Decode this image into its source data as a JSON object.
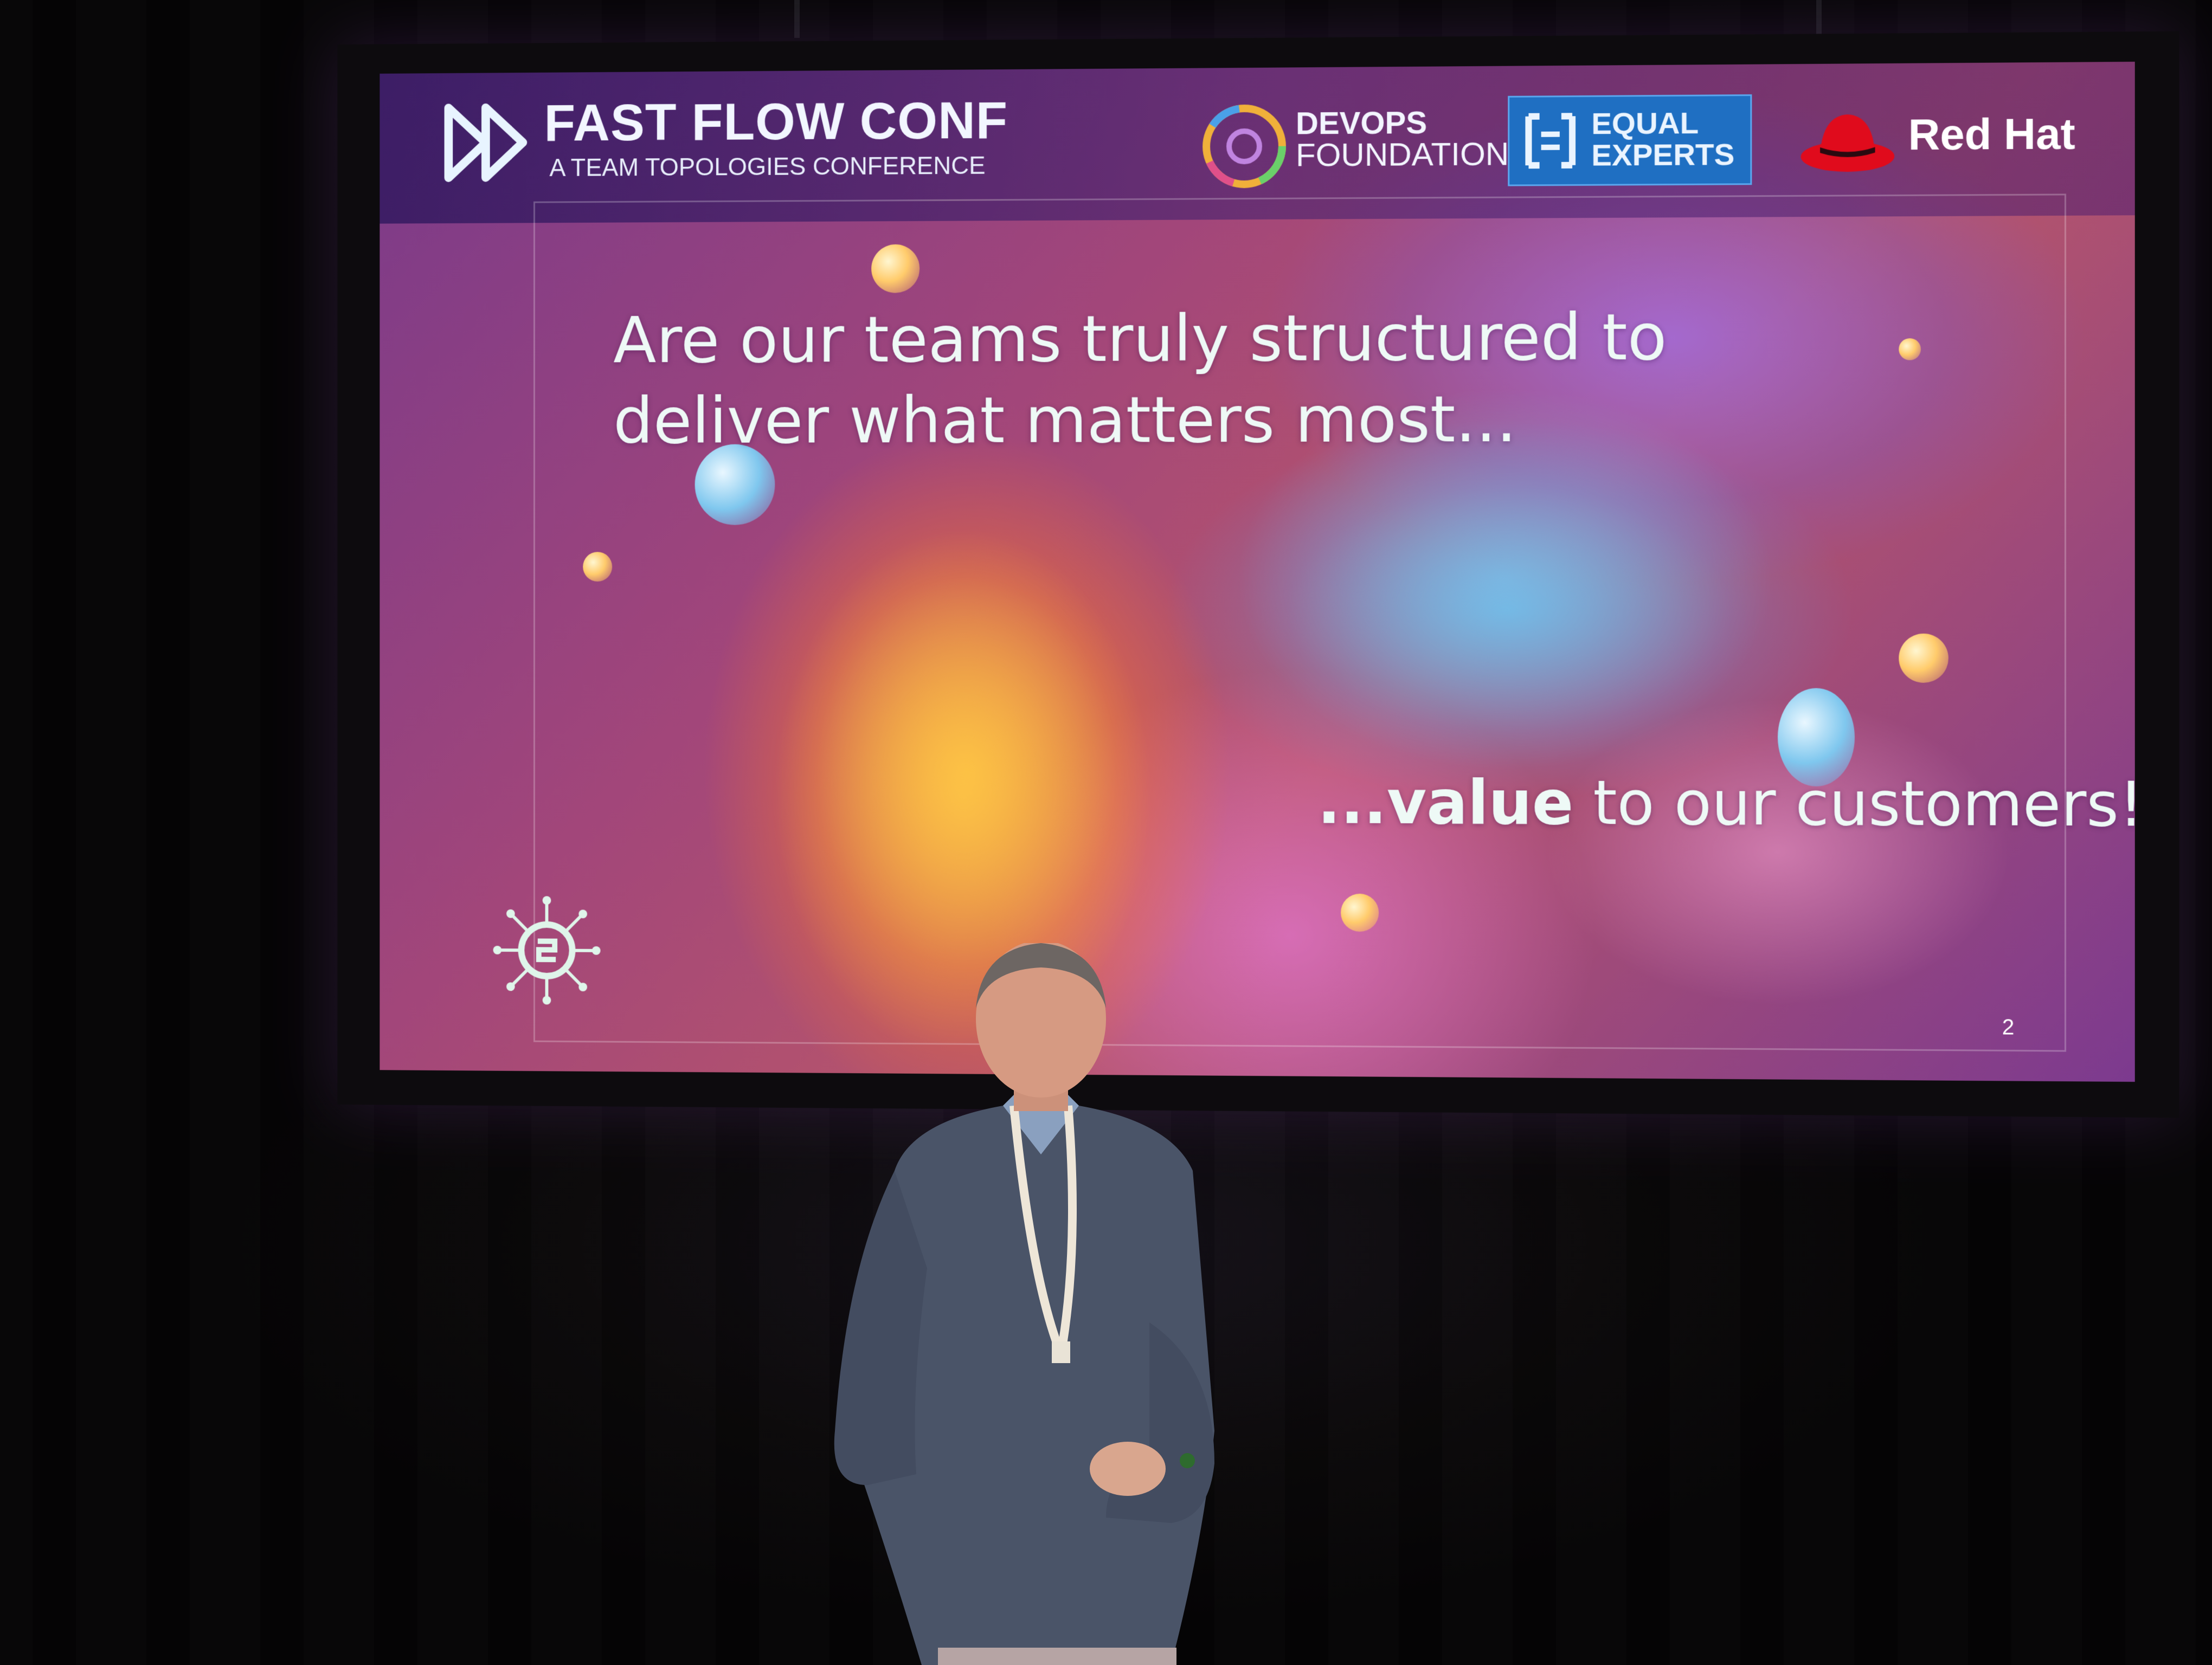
{
  "conference": {
    "name": "FAST FLOW CONF",
    "tagline": "A TEAM TOPOLOGIES CONFERENCE"
  },
  "sponsors": [
    {
      "line1": "DEVOPS",
      "line2": "FOUNDATION"
    },
    {
      "line1": "EQUAL",
      "line2": "EXPERTS"
    },
    {
      "name": "Red Hat"
    }
  ],
  "slide": {
    "line1": "Are our teams truly structured to",
    "line2": "deliver what matters most...",
    "bottom_prefix": "...",
    "bottom_emphasis": "value",
    "bottom_rest": " to our customers!",
    "page_number": "2"
  },
  "colors": {
    "equal_experts_blue": "#1f6fc2",
    "red_hat_red": "#e00b1c",
    "slide_text": "#eef9f6"
  },
  "icons": [
    "fast-forward-icon",
    "devops-foundation-icon",
    "equal-experts-icon",
    "red-hat-fedora-icon",
    "circuit-logo-icon"
  ]
}
